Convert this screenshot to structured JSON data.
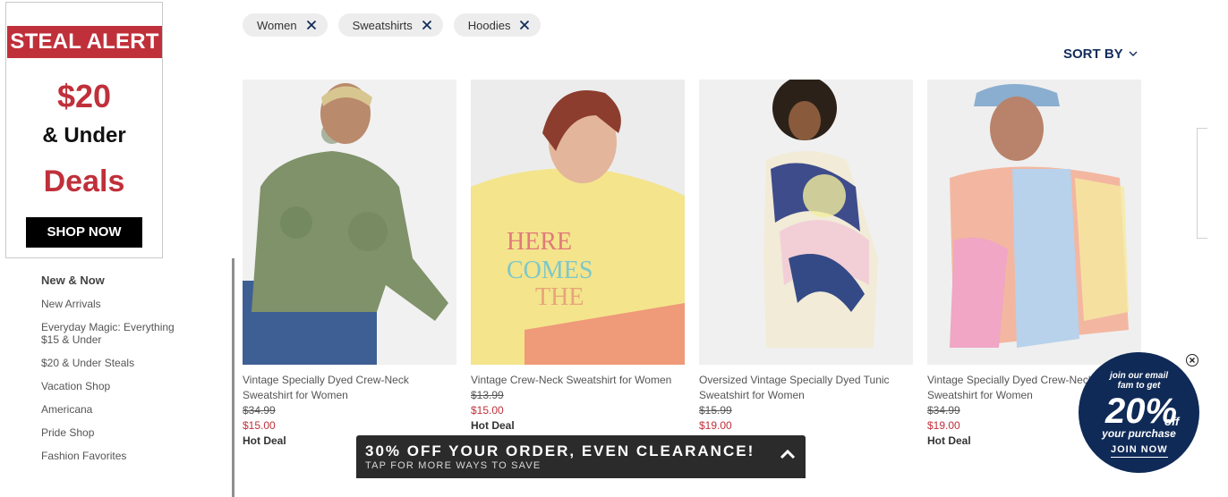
{
  "promo": {
    "banner": "STEAL ALERT",
    "price": "$20",
    "under": "& Under",
    "deals": "Deals",
    "button": "SHOP NOW",
    "accent_color": "#c0303a"
  },
  "nav": {
    "heading": "New & Now",
    "items": [
      "New Arrivals",
      "Everyday Magic: Everything $15 & Under",
      "$20 & Under Steals",
      "Vacation Shop",
      "Americana",
      "Pride Shop",
      "Fashion Favorites"
    ]
  },
  "filters": {
    "chips": [
      "Women",
      "Sweatshirts",
      "Hoodies"
    ],
    "remove_icon": "close-icon"
  },
  "sort": {
    "label": "SORT BY",
    "icon": "chevron-down-icon"
  },
  "products": [
    {
      "name": "Vintage Specially Dyed Crew-Neck Sweatshirt for Women",
      "was": "$34.99",
      "now": "$15.00",
      "badge": "Hot Deal"
    },
    {
      "name": "Vintage Crew-Neck Sweatshirt for Women",
      "was": "$13.99",
      "now": "$15.00",
      "badge": "Hot Deal"
    },
    {
      "name": "Oversized Vintage Specially Dyed Tunic Sweatshirt for Women",
      "was": "$15.99",
      "now": "$19.00",
      "badge": ""
    },
    {
      "name": "Vintage Specially Dyed Crew-Neck Sweatshirt for Women",
      "was": "$34.99",
      "now": "$19.00",
      "badge": "Hot Deal"
    }
  ],
  "banner": {
    "title": "30% OFF YOUR ORDER, EVEN CLEARANCE!",
    "subtitle": "TAP FOR MORE WAYS TO SAVE",
    "icon": "chevron-up-icon"
  },
  "email_signup": {
    "line1a": "join our email",
    "line1b": "fam to get",
    "percent": "20%",
    "off": "off",
    "line2": "your purchase",
    "cta": "JOIN NOW",
    "bg_color": "#0f2a57"
  },
  "colors": {
    "sale_red": "#c0303a",
    "navy": "#122c5a"
  }
}
